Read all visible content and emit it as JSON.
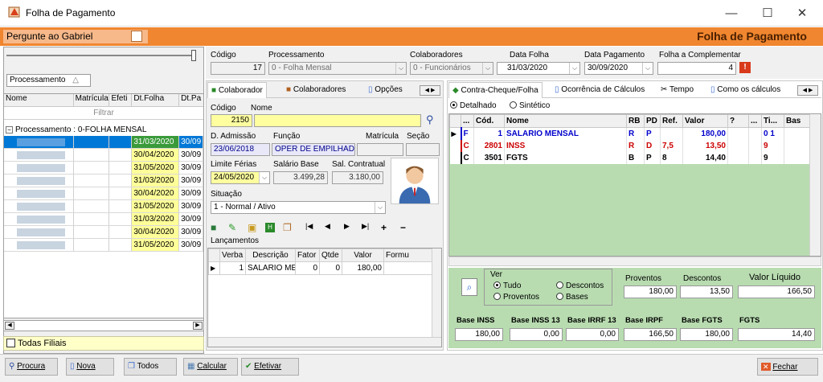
{
  "window": {
    "title": "Folha de Pagamento",
    "minimize": "—",
    "maximize": "☐",
    "close": "✕"
  },
  "header": {
    "ask": "Pergunte ao Gabriel",
    "title": "Folha de Pagamento"
  },
  "left": {
    "group_by": "Processamento",
    "group_sort": "△",
    "columns": [
      "Nome",
      "Matrícula",
      "Efeti",
      "Dt.Folha",
      "Dt.Pa"
    ],
    "filter": "Filtrar",
    "group_label": "Processamento : 0-FOLHA MENSAL",
    "rows": [
      {
        "dt_folha": "31/03/2020",
        "dt_pag": "30/09"
      },
      {
        "dt_folha": "30/04/2020",
        "dt_pag": "30/09"
      },
      {
        "dt_folha": "31/05/2020",
        "dt_pag": "30/09"
      },
      {
        "dt_folha": "31/03/2020",
        "dt_pag": "30/09"
      },
      {
        "dt_folha": "30/04/2020",
        "dt_pag": "30/09"
      },
      {
        "dt_folha": "31/05/2020",
        "dt_pag": "30/09"
      },
      {
        "dt_folha": "31/03/2020",
        "dt_pag": "30/09"
      },
      {
        "dt_folha": "30/04/2020",
        "dt_pag": "30/09"
      },
      {
        "dt_folha": "31/05/2020",
        "dt_pag": "30/09"
      }
    ],
    "todas_filiais": "Todas Filiais"
  },
  "top": {
    "codigo_label": "Código",
    "codigo": "17",
    "proc_label": "Processamento",
    "proc": "0 - Folha Mensal",
    "colab_label": "Colaboradores",
    "colab": "0 - Funcionários",
    "dtfolha_label": "Data Folha",
    "dtfolha": "31/03/2020",
    "dtpag_label": "Data Pagamento",
    "dtpag": "30/09/2020",
    "fcomp_label": "Folha a Complementar",
    "fcomp": "4"
  },
  "mid": {
    "tabs": [
      "Colaborador",
      "Colaboradores",
      "Opções"
    ],
    "codigo_label": "Código",
    "nome_label": "Nome",
    "codigo": "2150",
    "dadm_label": "D. Admissão",
    "dadm": "23/06/2018",
    "funcao_label": "Função",
    "funcao": "OPER DE EMPILHAD",
    "matricula_label": "Matrícula",
    "secao_label": "Seção",
    "limfer_label": "Limite Férias",
    "limfer": "24/05/2020",
    "salbase_label": "Salário Base",
    "salbase": "3.499,28",
    "salcont_label": "Sal. Contratual",
    "salcont": "3.180,00",
    "situacao_label": "Situação",
    "situacao": "1 - Normal / Ativo",
    "lanc_label": "Lançamentos",
    "lanc_cols": [
      "Verba",
      "Descrição",
      "Fator",
      "Qtde",
      "Valor",
      "Formu"
    ],
    "lanc_row": {
      "verba": "1",
      "desc": "SALARIO MENS",
      "fator": "0",
      "qtde": "0",
      "valor": "180,00"
    }
  },
  "right": {
    "tabs": [
      "Contra-Cheque/Folha",
      "Ocorrência de Cálculos",
      "Tempo",
      "Como os cálculos"
    ],
    "detalhado": "Detalhado",
    "sintetico": "Sintético",
    "cols": [
      "...",
      "Cód.",
      "Nome",
      "RB",
      "PD",
      "Ref.",
      "Valor",
      "?",
      "...",
      "Ti...",
      "Bas"
    ],
    "rows": [
      {
        "t": "F",
        "cod": "1",
        "nome": "SALARIO MENSAL",
        "rb": "R",
        "pd": "P",
        "ref": "",
        "valor": "180,00",
        "ti": "0 1",
        "color": "#0000cc"
      },
      {
        "t": "C",
        "cod": "2801",
        "nome": "INSS",
        "rb": "R",
        "pd": "D",
        "ref": "7,5",
        "valor": "13,50",
        "ti": "9",
        "color": "#cc0000"
      },
      {
        "t": "C",
        "cod": "3501",
        "nome": "FGTS",
        "rb": "B",
        "pd": "P",
        "ref": "8",
        "valor": "14,40",
        "ti": "9",
        "color": "#000000"
      }
    ],
    "ver_label": "Ver",
    "tudo": "Tudo",
    "descontos": "Descontos",
    "proventos_r": "Proventos",
    "bases": "Bases",
    "proventos_label": "Proventos",
    "proventos": "180,00",
    "descontos_label": "Descontos",
    "descontos_v": "13,50",
    "liquido_label": "Valor Líquido",
    "liquido": "166,50",
    "bases_list": [
      {
        "label": "Base INSS",
        "value": "180,00"
      },
      {
        "label": "Base INSS 13",
        "value": "0,00"
      },
      {
        "label": "Base IRRF 13",
        "value": "0,00"
      },
      {
        "label": "Base IRPF",
        "value": "166,50"
      },
      {
        "label": "Base FGTS",
        "value": "180,00"
      },
      {
        "label": "FGTS",
        "value": "14,40"
      }
    ]
  },
  "footer": {
    "procura": "Procura",
    "nova": "Nova",
    "todos": "Todos",
    "calcular": "Calcular",
    "efetivar": "Efetivar",
    "fechar": "Fechar"
  }
}
